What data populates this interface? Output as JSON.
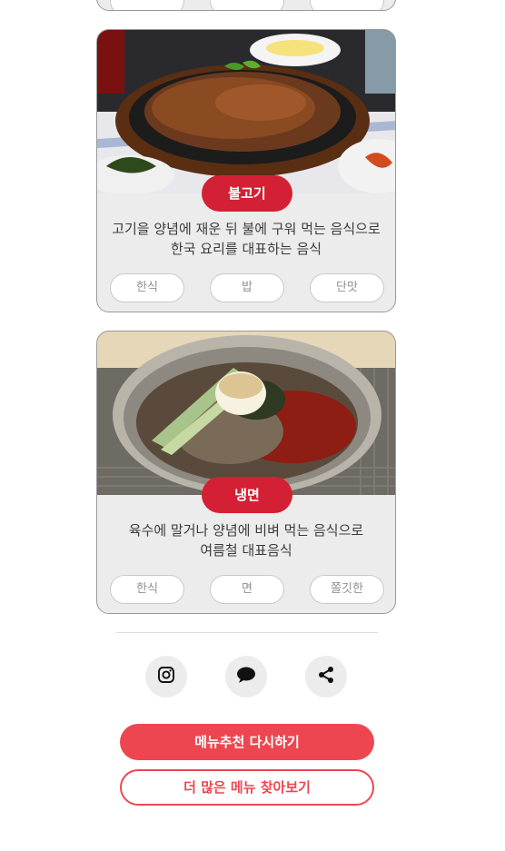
{
  "cards": [
    {
      "name": "불고기",
      "desc_line1": "고기을 양념에 재운 뒤 불에 구워 먹는 음식으로",
      "desc_line2": "한국 요리를 대표하는 음식",
      "tags": [
        "한식",
        "밥",
        "단맛"
      ]
    },
    {
      "name": "냉면",
      "desc_line1": "육수에 말거나 양념에 비벼 먹는 음식으로",
      "desc_line2": "여름철 대표음식",
      "tags": [
        "한식",
        "면",
        "쫄깃한"
      ]
    }
  ],
  "share": {
    "icons": [
      "instagram-icon",
      "chat-bubble-icon",
      "share-icon"
    ]
  },
  "actions": {
    "retry_label": "메뉴추천 다시하기",
    "more_label": "더 많은 메뉴 찾아보기"
  },
  "colors": {
    "badge": "#d42034",
    "primary": "#ee4650",
    "card_bg": "#ececec"
  }
}
